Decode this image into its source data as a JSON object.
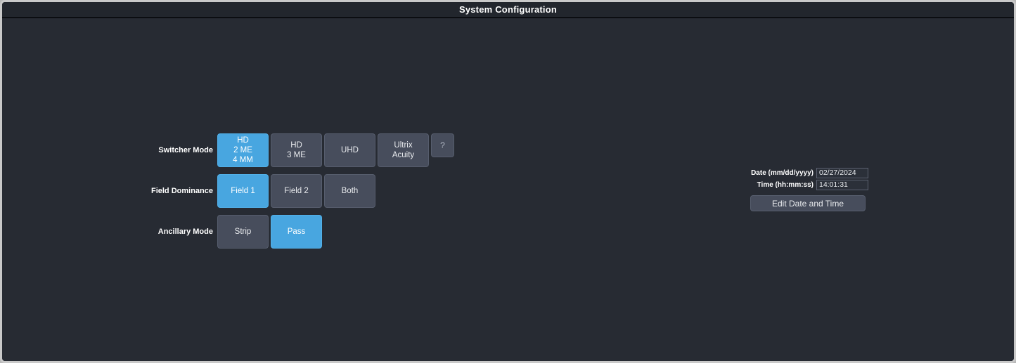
{
  "window": {
    "title": "System Configuration"
  },
  "rows": [
    {
      "label": "Switcher Mode",
      "name": "switcher-mode",
      "options": [
        {
          "lines": [
            "HD",
            "2 ME",
            "4 MM"
          ],
          "selected": true
        },
        {
          "lines": [
            "HD",
            "3 ME"
          ],
          "selected": false
        },
        {
          "lines": [
            "UHD"
          ],
          "selected": false
        },
        {
          "lines": [
            "Ultrix",
            "Acuity"
          ],
          "selected": false
        }
      ],
      "help": "?"
    },
    {
      "label": "Field Dominance",
      "name": "field-dominance",
      "options": [
        {
          "lines": [
            "Field 1"
          ],
          "selected": true
        },
        {
          "lines": [
            "Field 2"
          ],
          "selected": false
        },
        {
          "lines": [
            "Both"
          ],
          "selected": false
        }
      ]
    },
    {
      "label": "Ancillary Mode",
      "name": "ancillary-mode",
      "options": [
        {
          "lines": [
            "Strip"
          ],
          "selected": false
        },
        {
          "lines": [
            "Pass"
          ],
          "selected": true
        }
      ]
    }
  ],
  "datetime": {
    "date_label": "Date (mm/dd/yyyy)",
    "date_value": "02/27/2024",
    "time_label": "Time (hh:mm:ss)",
    "time_value": "14:01:31",
    "edit_button_label": "Edit Date and Time"
  },
  "colors": {
    "background": "#272b33",
    "title_bar": "#22262d",
    "button_unselected": "#474d5c",
    "button_selected": "#48a6e0",
    "text": "#e9ebee",
    "window_border": "#c9c9c9"
  }
}
